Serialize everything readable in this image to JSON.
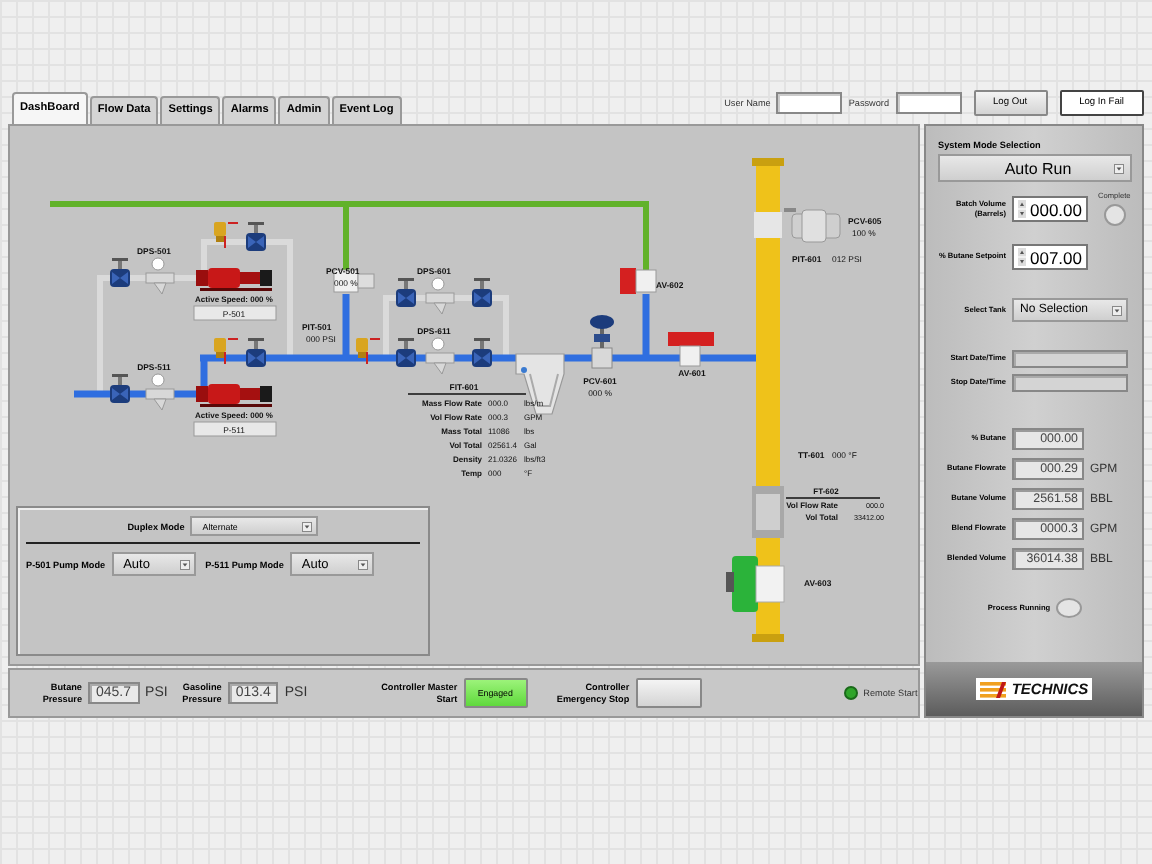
{
  "tabs": [
    {
      "label": "DashBoard",
      "selected": true
    },
    {
      "label": "Flow Data",
      "selected": false
    },
    {
      "label": "Settings",
      "selected": false
    },
    {
      "label": "Alarms",
      "selected": false
    },
    {
      "label": "Admin",
      "selected": false
    },
    {
      "label": "Event Log",
      "selected": false
    }
  ],
  "login": {
    "user_name_label": "User Name",
    "password_label": "Password",
    "log_out": "Log Out",
    "log_in": "Log In Fail"
  },
  "diagram": {
    "pumps": [
      {
        "tag": "P-501",
        "speed": "Active Speed: 000 %"
      },
      {
        "tag": "P-511",
        "speed": "Active Speed: 000 %"
      }
    ],
    "strainers": [
      {
        "tag": "DPS-501"
      },
      {
        "tag": "DPS-511"
      },
      {
        "tag": "DPS-601"
      },
      {
        "tag": "DPS-611"
      }
    ],
    "instruments": [
      {
        "tag": "PCV-501",
        "value": "000 %"
      },
      {
        "tag": "PIT-501",
        "value": "000 PSI"
      },
      {
        "tag": "PCV-601",
        "value": "000 %"
      },
      {
        "tag": "AV-602"
      },
      {
        "tag": "AV-601"
      },
      {
        "tag": "PCV-605",
        "value": "100 %"
      },
      {
        "tag": "PIT-601",
        "value": "012 PSI"
      },
      {
        "tag": "TT-601",
        "value": "000 °F"
      },
      {
        "tag": "AV-603"
      }
    ],
    "fit_601": {
      "title": "FIT-601",
      "rows": [
        {
          "label": "Mass Flow Rate",
          "value": "000.0",
          "unit": "lbs/m"
        },
        {
          "label": "Vol Flow Rate",
          "value": "000.3",
          "unit": "GPM"
        },
        {
          "label": "Mass Total",
          "value": "11086",
          "unit": "lbs"
        },
        {
          "label": "Vol Total",
          "value": "02561.4",
          "unit": "Gal"
        },
        {
          "label": "Density",
          "value": "21.0326",
          "unit": "lbs/ft3"
        },
        {
          "label": "Temp",
          "value": "000",
          "unit": "°F"
        }
      ]
    },
    "ft_602": {
      "title": "FT-602",
      "rows": [
        {
          "label": "Vol Flow Rate",
          "value": "000.0"
        },
        {
          "label": "Vol Total",
          "value": "33412.00"
        }
      ]
    }
  },
  "duplex": {
    "label": "Duplex Mode",
    "value": "Alternate",
    "pump_modes": [
      {
        "label": "P-501 Pump Mode",
        "value": "Auto"
      },
      {
        "label": "P-511 Pump Mode",
        "value": "Auto"
      }
    ]
  },
  "bottom_bar": {
    "pressures": [
      {
        "label": "Butane Pressure",
        "value": "045.7",
        "unit": "PSI"
      },
      {
        "label": "Gasoline Pressure",
        "value": "013.4",
        "unit": "PSI"
      }
    ],
    "master_start": {
      "label": "Controller Master Start",
      "button": "Engaged",
      "on": true
    },
    "emergency_stop": {
      "label": "Controller Emergency Stop",
      "on": false
    },
    "remote_start": {
      "label": "Remote Start",
      "on": true
    }
  },
  "mode_panel": {
    "title": "System Mode Selection",
    "mode": "Auto Run",
    "batch_volume": {
      "label": "Batch Volume (Barrels)",
      "value": "000.00"
    },
    "complete": {
      "label": "Complete",
      "on": false
    },
    "setpoint": {
      "label": "% Butane Setpoint",
      "value": "007.00"
    },
    "tank": {
      "label": "Select Tank",
      "value": "No Selection"
    },
    "dates": [
      {
        "label": "Start Date/Time"
      },
      {
        "label": "Stop Date/Time"
      }
    ],
    "readings": [
      {
        "label": "% Butane",
        "value": "000.00"
      },
      {
        "label": "Butane Flowrate",
        "value": "000.29",
        "unit": "GPM"
      },
      {
        "label": "Butane Volume",
        "value": "2561.58",
        "unit": "BBL"
      },
      {
        "label": "Blend Flowrate",
        "value": "0000.3",
        "unit": "GPM"
      },
      {
        "label": "Blended Volume",
        "value": "36014.38",
        "unit": "BBL"
      }
    ],
    "process_running": {
      "label": "Process Running",
      "on": false
    },
    "logo": "TECHNICS"
  }
}
